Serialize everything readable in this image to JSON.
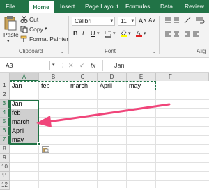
{
  "tabs": [
    "File",
    "Home",
    "Insert",
    "Page Layout",
    "Formulas",
    "Data",
    "Review"
  ],
  "ribbon": {
    "clipboard": {
      "paste": "Paste",
      "cut": "Cut",
      "copy": "Copy",
      "format_painter": "Format Painter",
      "group_label": "Clipboard"
    },
    "font": {
      "name": "Calibri",
      "size": "11",
      "group_label": "Font",
      "format_buttons": [
        "B",
        "I",
        "U"
      ],
      "grow_glyph": "A˄",
      "shrink_glyph": "A˅"
    },
    "alignment": {
      "group_label": "Alig"
    }
  },
  "formula_bar": {
    "name_box": "A3",
    "cancel": "✕",
    "enter": "✓",
    "fx": "fx",
    "value": "Jan"
  },
  "grid": {
    "columns": [
      "A",
      "B",
      "C",
      "D",
      "E",
      "F"
    ],
    "rows": [
      "1",
      "2",
      "3",
      "4",
      "5",
      "6",
      "7",
      "8",
      "9",
      "10",
      "11",
      "12"
    ],
    "row1": [
      "Jan",
      "feb",
      "march",
      "April",
      "may"
    ],
    "col_a": [
      "Jan",
      "feb",
      "march",
      "April",
      "may"
    ]
  },
  "colors": {
    "accent": "#217346",
    "arrow": "#f0457a",
    "selection": "#cfcfcf"
  }
}
